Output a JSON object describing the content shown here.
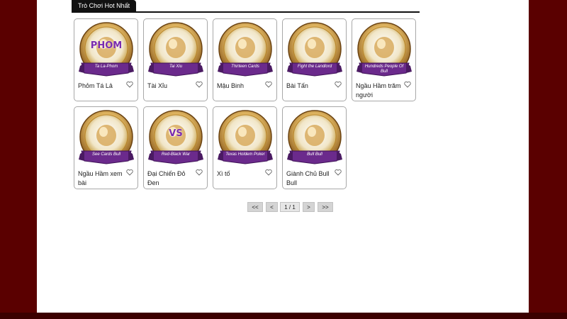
{
  "section": {
    "title": "Trò Chơi Hot Nhất"
  },
  "games": [
    {
      "name": "Phỏm Tá Lả",
      "badge": "Ta La-Phom",
      "logo": "PHOM",
      "accent": "#6b2a8c"
    },
    {
      "name": "Tài Xỉu",
      "badge": "Tai Xiu",
      "logo": "",
      "accent": "#6b2a8c"
    },
    {
      "name": "Mậu Binh",
      "badge": "Thirteen Cards",
      "logo": "",
      "accent": "#6b2a8c"
    },
    {
      "name": "Bài Tấn",
      "badge": "Fight the Landlord",
      "logo": "",
      "accent": "#6b2a8c"
    },
    {
      "name": "Ngầu Hầm trăm người",
      "badge": "Hundreds People Of Bull",
      "logo": "",
      "accent": "#6b2a8c"
    },
    {
      "name": "Ngầu Hầm xem bài",
      "badge": "See Cards Bull",
      "logo": "",
      "accent": "#6b2a8c"
    },
    {
      "name": "Đại Chiến Đỏ Đen",
      "badge": "Red-Black War",
      "logo": "VS",
      "accent": "#6b2a8c"
    },
    {
      "name": "Xì tố",
      "badge": "Texas Holdem Poker",
      "logo": "",
      "accent": "#6b2a8c"
    },
    {
      "name": "Giành Chủ Bull Bull",
      "badge": "Bull Bull",
      "logo": "",
      "accent": "#6b2a8c"
    }
  ],
  "pagination": {
    "first": "<<",
    "prev": "<",
    "page": "1 / 1",
    "next": ">",
    "last": ">>"
  },
  "colors": {
    "frame": "#5a0000",
    "gold": "#c9a24a",
    "purple": "#6b2a8c"
  }
}
